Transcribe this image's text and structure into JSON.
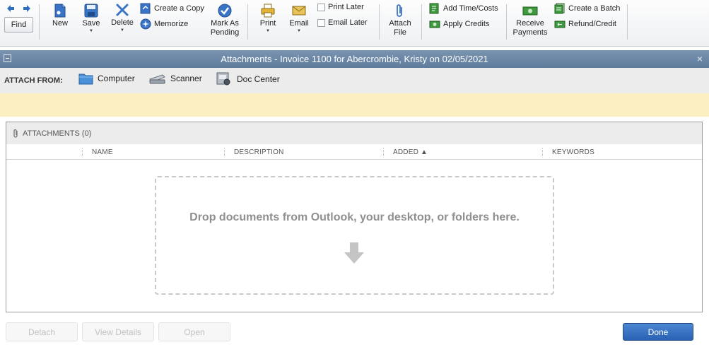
{
  "toolbar": {
    "find": "Find",
    "new": "New",
    "save": "Save",
    "delete": "Delete",
    "create_copy": "Create a Copy",
    "memorize": "Memorize",
    "mark_as_pending_1": "Mark As",
    "mark_as_pending_2": "Pending",
    "print": "Print",
    "email": "Email",
    "print_later": "Print Later",
    "email_later": "Email Later",
    "attach_file_1": "Attach",
    "attach_file_2": "File",
    "add_time_costs": "Add Time/Costs",
    "apply_credits": "Apply Credits",
    "receive_payments_1": "Receive",
    "receive_payments_2": "Payments",
    "create_batch": "Create a Batch",
    "refund_credit": "Refund/Credit"
  },
  "window": {
    "title": "Attachments - Invoice 1100 for Abercrombie, Kristy on 02/05/2021",
    "close": "×"
  },
  "attach_from": {
    "label": "ATTACH FROM:",
    "sources": [
      "Computer",
      "Scanner",
      "Doc Center"
    ]
  },
  "attachments": {
    "header": "ATTACHMENTS (0)",
    "columns": [
      "NAME",
      "DESCRIPTION",
      "ADDED ▲",
      "KEYWORDS"
    ],
    "drop_message": "Drop documents from Outlook, your desktop, or folders here."
  },
  "footer": {
    "detach": "Detach",
    "view_details": "View Details",
    "open": "Open",
    "done": "Done"
  }
}
